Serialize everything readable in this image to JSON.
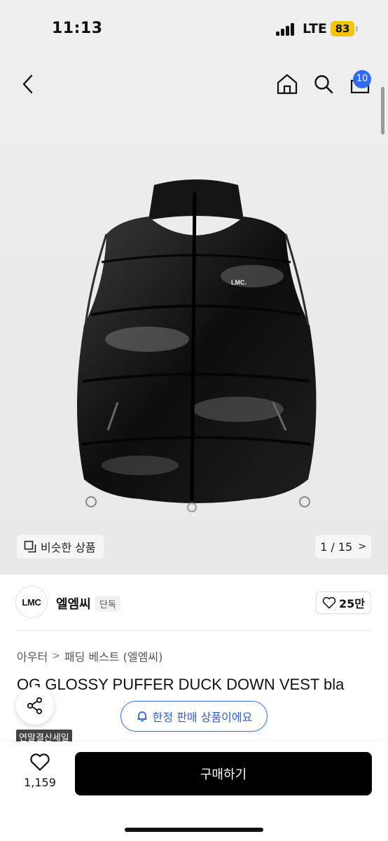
{
  "status_bar": {
    "time": "11:13",
    "network": "LTE",
    "battery": "83"
  },
  "header": {
    "cart_count": "10"
  },
  "gallery": {
    "similar_label": "비슷한 상품",
    "pager": "1 / 15",
    "product_logo_text": "LMC."
  },
  "brand": {
    "logo_text": "LMC",
    "name": "엘엠씨",
    "tag": "단독",
    "likes": "25만"
  },
  "breadcrumb": {
    "category": "아우터",
    "subcategory": "패딩 베스트 (엘엠씨)"
  },
  "product": {
    "title": "OG GLOSSY PUFFER DUCK DOWN VEST bla"
  },
  "limited_notice": "한정 판매 상품이에요",
  "sale_tag": "연말결산세일",
  "bottom_bar": {
    "wish_count": "1,159",
    "buy_label": "구매하기"
  },
  "colors": {
    "accent_blue": "#2f6bff",
    "buy_button": "#000000"
  }
}
